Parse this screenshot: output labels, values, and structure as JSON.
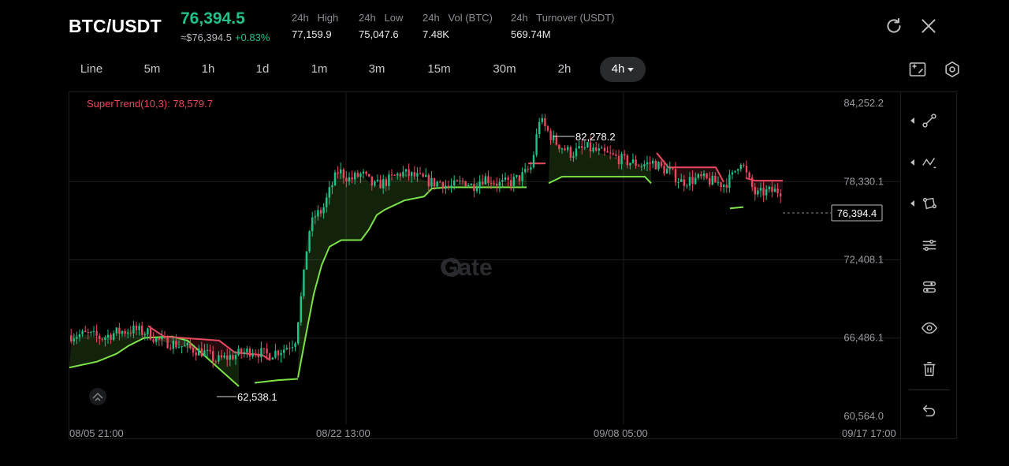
{
  "header": {
    "pair": "BTC/USDT",
    "last_price": "76,394.5",
    "fiat_price": "≈$76,394.5",
    "change": "+0.83%",
    "stats": [
      {
        "label": "24h   High",
        "value": "77,159.9"
      },
      {
        "label": "24h   Low",
        "value": "75,047.6"
      },
      {
        "label": "24h   Vol (BTC)",
        "value": "7.48K"
      },
      {
        "label": "24h   Turnover (USDT)",
        "value": "569.74M"
      }
    ],
    "icons": [
      "refresh-icon",
      "close-icon"
    ]
  },
  "intervals": {
    "items": [
      "Line",
      "5m",
      "1h",
      "1d",
      "1m",
      "3m",
      "15m",
      "30m",
      "2h",
      "4h"
    ],
    "active": "4h",
    "right_icons": [
      "chart-type-icon",
      "settings-icon"
    ]
  },
  "chart_data": {
    "type": "candlestick",
    "indicator_label": "SuperTrend(10,3): 78,579.7",
    "y_ticks": [
      "84,252.2",
      "78,330.1",
      "72,408.1",
      "66,486.1",
      "60,564.0"
    ],
    "ylim": [
      60564.0,
      84252.2
    ],
    "x_ticks": [
      "08/05 21:00",
      "08/22 13:00",
      "09/08 05:00",
      "09/17 17:00"
    ],
    "high_marker": "82,278.2",
    "low_marker": "62,538.1",
    "current_price_tag": "76,394.4",
    "watermark": "Gate",
    "colors": {
      "up": "#21c18a",
      "down": "#e8485d",
      "supertrend_up": "#7de34a",
      "supertrend_down": "#e8485d"
    }
  },
  "sidebar": {
    "tools": [
      "trend-line-icon",
      "polyline-icon",
      "shape-icon",
      "indicator-settings-icon",
      "indicator-list-icon",
      "eye-icon",
      "trash-icon",
      "undo-icon"
    ]
  }
}
